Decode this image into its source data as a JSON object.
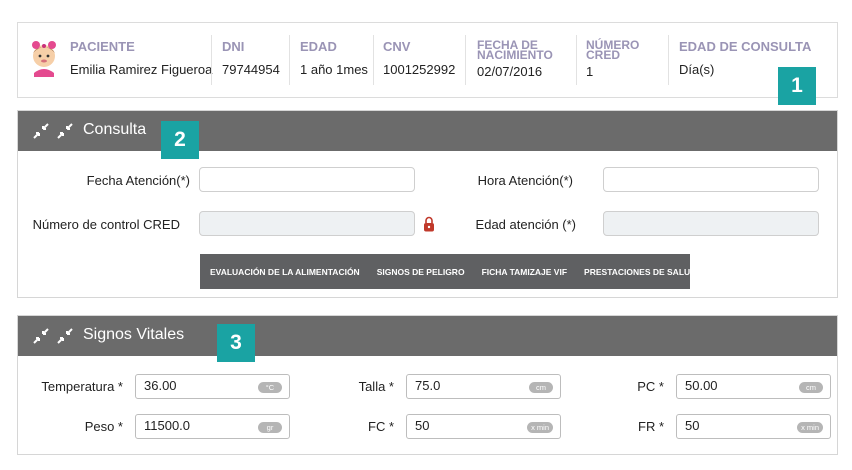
{
  "patient": {
    "columns": [
      {
        "label": "PACIENTE",
        "value": "Emilia Ramirez Figueroa"
      },
      {
        "label": "DNI",
        "value": "79744954"
      },
      {
        "label": "EDAD",
        "value": "1 año 1mes"
      },
      {
        "label": "CNV",
        "value": "1001252992"
      },
      {
        "label_line1": "FECHA DE",
        "label_line2": "NACIMIENTO",
        "value": "02/07/2016"
      },
      {
        "label_line1": "NÚMERO",
        "label_line2": "CRED",
        "value": "1"
      },
      {
        "label": "EDAD DE CONSULTA",
        "value": "Día(s)"
      }
    ],
    "avatar_icon": "baby-girl-icon"
  },
  "badges": [
    "1",
    "2",
    "3"
  ],
  "consulta": {
    "title": "Consulta",
    "fecha_atencion_label": "Fecha Atención(*)",
    "fecha_atencion_value": "",
    "hora_atencion_label": "Hora Atención(*)",
    "hora_atencion_value": "",
    "numero_control_label": "Número de control CRED",
    "numero_control_value": "",
    "edad_atencion_label": "Edad atención (*)",
    "edad_atencion_value": "",
    "tabs": [
      "EVALUACIÓN DE LA ALIMENTACIÓN",
      "SIGNOS DE PELIGRO",
      "FICHA TAMIZAJE VIF",
      "PRESTACIONES DE SALUD"
    ]
  },
  "signos": {
    "title": "Signos Vitales",
    "fields": [
      {
        "label": "Temperatura *",
        "value": "36.00",
        "unit": "°C"
      },
      {
        "label": "Talla *",
        "value": "75.0",
        "unit": "cm"
      },
      {
        "label": "PC *",
        "value": "50.00",
        "unit": "cm"
      },
      {
        "label": "Peso *",
        "value": "11500.0",
        "unit": "gr"
      },
      {
        "label": "FC *",
        "value": "50",
        "unit": "x min"
      },
      {
        "label": "FR *",
        "value": "50",
        "unit": "x min"
      }
    ]
  },
  "colors": {
    "header_label": "#9a94b5",
    "panel_header": "#6b6b6b",
    "badge": "#1aa3a3",
    "tabbar": "#5f6062",
    "lock": "#c0392b"
  }
}
